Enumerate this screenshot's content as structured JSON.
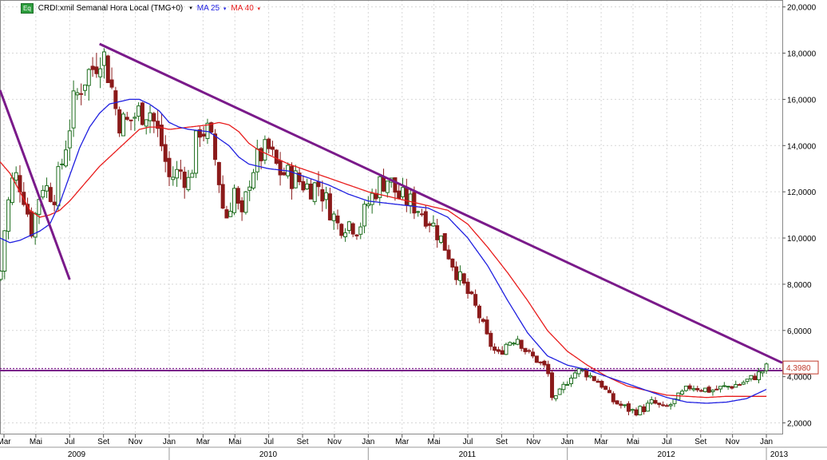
{
  "header": {
    "badge": "Eq",
    "title": "CRDI:xmil Semanal Hora Local (TMG+0)",
    "ma25_label": "MA 25",
    "ma40_label": "MA 40",
    "caret": "▾"
  },
  "colors": {
    "ma25": "#1f1fe0",
    "ma40": "#e81c1c",
    "trendline": "#7a1a8a",
    "support": "#7a1a8a",
    "candle_up": "#1f6e1f",
    "candle_down": "#8b1a1a",
    "grid": "#d7d7d7",
    "price_tag": "#c0392b"
  },
  "chart_data": {
    "type": "candlestick",
    "title": "CRDI:xmil Semanal Hora Local (TMG+0)",
    "ylim": [
      1.5,
      20.3
    ],
    "xlim": [
      2009.15,
      2013.08
    ],
    "y_ticks": [
      {
        "v": 2,
        "label": "2,0000"
      },
      {
        "v": 4,
        "label": "4,0000"
      },
      {
        "v": 6,
        "label": "6,0000"
      },
      {
        "v": 8,
        "label": "8,0000"
      },
      {
        "v": 10,
        "label": "10,0000"
      },
      {
        "v": 12,
        "label": "12,0000"
      },
      {
        "v": 14,
        "label": "14,0000"
      },
      {
        "v": 16,
        "label": "16,0000"
      },
      {
        "v": 18,
        "label": "18,0000"
      },
      {
        "v": 20,
        "label": "20,0000"
      }
    ],
    "month_ticks": [
      {
        "t": 2009.17,
        "label": "Mar"
      },
      {
        "t": 2009.33,
        "label": "Mai"
      },
      {
        "t": 2009.5,
        "label": "Jul"
      },
      {
        "t": 2009.67,
        "label": "Set"
      },
      {
        "t": 2009.83,
        "label": "Nov"
      },
      {
        "t": 2010.0,
        "label": "Jan"
      },
      {
        "t": 2010.17,
        "label": "Mar"
      },
      {
        "t": 2010.33,
        "label": "Mai"
      },
      {
        "t": 2010.5,
        "label": "Jul"
      },
      {
        "t": 2010.67,
        "label": "Set"
      },
      {
        "t": 2010.83,
        "label": "Nov"
      },
      {
        "t": 2011.0,
        "label": "Jan"
      },
      {
        "t": 2011.17,
        "label": "Mar"
      },
      {
        "t": 2011.33,
        "label": "Mai"
      },
      {
        "t": 2011.5,
        "label": "Jul"
      },
      {
        "t": 2011.67,
        "label": "Set"
      },
      {
        "t": 2011.83,
        "label": "Nov"
      },
      {
        "t": 2012.0,
        "label": "Jan"
      },
      {
        "t": 2012.17,
        "label": "Mar"
      },
      {
        "t": 2012.33,
        "label": "Mai"
      },
      {
        "t": 2012.5,
        "label": "Jul"
      },
      {
        "t": 2012.67,
        "label": "Set"
      },
      {
        "t": 2012.83,
        "label": "Nov"
      },
      {
        "t": 2013.0,
        "label": "Jan"
      }
    ],
    "year_ticks": [
      {
        "t": 2009.15,
        "label": "2009"
      },
      {
        "t": 2010.0,
        "label": "2010"
      },
      {
        "t": 2011.0,
        "label": "2011"
      },
      {
        "t": 2012.0,
        "label": "2012"
      },
      {
        "t": 2013.0,
        "label": "2013"
      }
    ],
    "last_price_label": "4,3980",
    "last_price": 4.398,
    "price_anchors": [
      [
        2009.15,
        8.2
      ],
      [
        2009.18,
        11.0
      ],
      [
        2009.22,
        12.8
      ],
      [
        2009.26,
        12.2
      ],
      [
        2009.31,
        10.3
      ],
      [
        2009.36,
        12.4
      ],
      [
        2009.42,
        11.8
      ],
      [
        2009.46,
        13.2
      ],
      [
        2009.52,
        15.8
      ],
      [
        2009.57,
        16.9
      ],
      [
        2009.62,
        17.4
      ],
      [
        2009.66,
        18.2
      ],
      [
        2009.7,
        17.0
      ],
      [
        2009.74,
        15.2
      ],
      [
        2009.78,
        14.9
      ],
      [
        2009.84,
        15.4
      ],
      [
        2009.9,
        15.6
      ],
      [
        2009.96,
        14.1
      ],
      [
        2010.0,
        12.6
      ],
      [
        2010.06,
        12.9
      ],
      [
        2010.1,
        12.4
      ],
      [
        2010.15,
        14.8
      ],
      [
        2010.2,
        14.5
      ],
      [
        2010.24,
        13.1
      ],
      [
        2010.28,
        10.7
      ],
      [
        2010.33,
        12.2
      ],
      [
        2010.36,
        10.5
      ],
      [
        2010.41,
        12.9
      ],
      [
        2010.46,
        13.6
      ],
      [
        2010.5,
        13.8
      ],
      [
        2010.55,
        12.9
      ],
      [
        2010.6,
        12.7
      ],
      [
        2010.65,
        12.5
      ],
      [
        2010.7,
        12.2
      ],
      [
        2010.75,
        12.3
      ],
      [
        2010.8,
        11.4
      ],
      [
        2010.85,
        10.5
      ],
      [
        2010.9,
        10.7
      ],
      [
        2010.95,
        10.4
      ],
      [
        2011.0,
        11.5
      ],
      [
        2011.05,
        12.3
      ],
      [
        2011.1,
        12.6
      ],
      [
        2011.15,
        11.8
      ],
      [
        2011.2,
        11.6
      ],
      [
        2011.25,
        11.3
      ],
      [
        2011.3,
        10.9
      ],
      [
        2011.35,
        10.2
      ],
      [
        2011.4,
        9.4
      ],
      [
        2011.45,
        8.4
      ],
      [
        2011.5,
        7.6
      ],
      [
        2011.55,
        6.8
      ],
      [
        2011.6,
        5.6
      ],
      [
        2011.65,
        4.9
      ],
      [
        2011.7,
        5.5
      ],
      [
        2011.75,
        5.7
      ],
      [
        2011.8,
        5.0
      ],
      [
        2011.85,
        4.7
      ],
      [
        2011.9,
        4.3
      ],
      [
        2011.93,
        2.8
      ],
      [
        2011.97,
        3.4
      ],
      [
        2012.02,
        4.1
      ],
      [
        2012.07,
        4.3
      ],
      [
        2012.12,
        4.0
      ],
      [
        2012.17,
        3.7
      ],
      [
        2012.22,
        3.0
      ],
      [
        2012.28,
        2.7
      ],
      [
        2012.33,
        2.5
      ],
      [
        2012.38,
        2.6
      ],
      [
        2012.43,
        2.9
      ],
      [
        2012.48,
        2.6
      ],
      [
        2012.52,
        2.8
      ],
      [
        2012.57,
        3.2
      ],
      [
        2012.62,
        3.6
      ],
      [
        2012.67,
        3.5
      ],
      [
        2012.72,
        3.4
      ],
      [
        2012.77,
        3.5
      ],
      [
        2012.82,
        3.6
      ],
      [
        2012.87,
        3.7
      ],
      [
        2012.92,
        3.9
      ],
      [
        2012.96,
        4.1
      ],
      [
        2013.0,
        4.4
      ]
    ],
    "ma25_anchors": [
      [
        2009.15,
        10.0
      ],
      [
        2009.2,
        9.8
      ],
      [
        2009.25,
        9.9
      ],
      [
        2009.3,
        10.1
      ],
      [
        2009.35,
        10.3
      ],
      [
        2009.4,
        10.6
      ],
      [
        2009.45,
        11.5
      ],
      [
        2009.5,
        12.7
      ],
      [
        2009.55,
        13.9
      ],
      [
        2009.6,
        14.8
      ],
      [
        2009.65,
        15.4
      ],
      [
        2009.7,
        15.8
      ],
      [
        2009.75,
        15.9
      ],
      [
        2009.8,
        16.0
      ],
      [
        2009.85,
        16.0
      ],
      [
        2009.9,
        15.8
      ],
      [
        2009.95,
        15.5
      ],
      [
        2010.0,
        15.0
      ],
      [
        2010.05,
        14.8
      ],
      [
        2010.1,
        14.7
      ],
      [
        2010.2,
        14.6
      ],
      [
        2010.3,
        14.0
      ],
      [
        2010.35,
        13.5
      ],
      [
        2010.4,
        13.2
      ],
      [
        2010.5,
        13.0
      ],
      [
        2010.6,
        12.9
      ],
      [
        2010.7,
        12.6
      ],
      [
        2010.8,
        12.3
      ],
      [
        2010.9,
        11.9
      ],
      [
        2011.0,
        11.6
      ],
      [
        2011.1,
        11.5
      ],
      [
        2011.2,
        11.4
      ],
      [
        2011.3,
        11.3
      ],
      [
        2011.4,
        10.9
      ],
      [
        2011.5,
        10.0
      ],
      [
        2011.6,
        8.8
      ],
      [
        2011.7,
        7.3
      ],
      [
        2011.8,
        5.9
      ],
      [
        2011.9,
        4.9
      ],
      [
        2012.0,
        4.5
      ],
      [
        2012.1,
        4.3
      ],
      [
        2012.2,
        4.0
      ],
      [
        2012.3,
        3.7
      ],
      [
        2012.4,
        3.4
      ],
      [
        2012.5,
        3.1
      ],
      [
        2012.6,
        2.9
      ],
      [
        2012.7,
        2.85
      ],
      [
        2012.8,
        2.9
      ],
      [
        2012.9,
        3.05
      ],
      [
        2013.0,
        3.45
      ]
    ],
    "ma40_anchors": [
      [
        2009.15,
        13.3
      ],
      [
        2009.2,
        12.8
      ],
      [
        2009.25,
        12.0
      ],
      [
        2009.3,
        11.2
      ],
      [
        2009.35,
        10.9
      ],
      [
        2009.4,
        11.0
      ],
      [
        2009.45,
        11.2
      ],
      [
        2009.5,
        11.6
      ],
      [
        2009.55,
        12.1
      ],
      [
        2009.6,
        12.6
      ],
      [
        2009.65,
        13.1
      ],
      [
        2009.7,
        13.5
      ],
      [
        2009.75,
        13.9
      ],
      [
        2009.8,
        14.3
      ],
      [
        2009.85,
        14.7
      ],
      [
        2009.9,
        14.8
      ],
      [
        2009.95,
        14.8
      ],
      [
        2010.0,
        14.7
      ],
      [
        2010.1,
        14.8
      ],
      [
        2010.2,
        14.9
      ],
      [
        2010.25,
        15.0
      ],
      [
        2010.3,
        14.9
      ],
      [
        2010.35,
        14.6
      ],
      [
        2010.4,
        14.1
      ],
      [
        2010.45,
        13.8
      ],
      [
        2010.5,
        13.6
      ],
      [
        2010.6,
        13.2
      ],
      [
        2010.7,
        12.9
      ],
      [
        2010.8,
        12.6
      ],
      [
        2010.9,
        12.3
      ],
      [
        2011.0,
        12.0
      ],
      [
        2011.1,
        11.8
      ],
      [
        2011.2,
        11.6
      ],
      [
        2011.3,
        11.4
      ],
      [
        2011.4,
        11.2
      ],
      [
        2011.5,
        10.6
      ],
      [
        2011.6,
        9.6
      ],
      [
        2011.7,
        8.5
      ],
      [
        2011.8,
        7.3
      ],
      [
        2011.9,
        6.0
      ],
      [
        2012.0,
        5.1
      ],
      [
        2012.1,
        4.5
      ],
      [
        2012.2,
        4.0
      ],
      [
        2012.3,
        3.6
      ],
      [
        2012.4,
        3.4
      ],
      [
        2012.5,
        3.2
      ],
      [
        2012.6,
        3.15
      ],
      [
        2012.7,
        3.1
      ],
      [
        2012.8,
        3.15
      ],
      [
        2012.9,
        3.15
      ],
      [
        2013.0,
        3.15
      ]
    ],
    "trendlines": [
      {
        "t1": 2009.15,
        "v1": 16.4,
        "t2": 2009.5,
        "v2": 8.2
      },
      {
        "t1": 2009.65,
        "v1": 18.4,
        "t2": 2013.08,
        "v2": 4.6
      }
    ],
    "support_level": 4.3
  }
}
